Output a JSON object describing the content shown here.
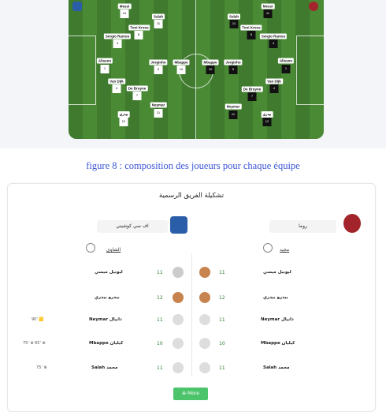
{
  "caption": "figure 8 : composition des joueurs pour chaque équipe",
  "pitch": {
    "left_cards": [
      "Salah",
      "Neymar",
      "Toni Kroos",
      "Sergio Ramos",
      "Alisson",
      "Van Dijk",
      "De Bruyne",
      "Jorginho",
      "Mbappe",
      "Neymar"
    ],
    "right_cards": [
      "Salah",
      "Neymar",
      "Toni Kroos",
      "Sergio Ramos",
      "Alisson",
      "Van Dijk",
      "De Bruyne",
      "Mbappe",
      "Jorginho",
      "Neymar"
    ],
    "left_mid_cards": [
      "Jorginho",
      "Mbappe"
    ],
    "right_mid_cards": [
      "Mbappe",
      "Jorginho"
    ]
  },
  "panel": {
    "title": "تشكيلة الفريق الرسمية",
    "team_left": "اف سي كوشيني",
    "team_right": "روما",
    "sec_left": "الشاوي",
    "sec_right": "مجيد",
    "more_label": "⊕ More",
    "rows": [
      {
        "left_name": "ليونيل ميسي",
        "left_num": "11",
        "right_num": "11",
        "right_name": "ليونيل ميسي",
        "left_ev": ""
      },
      {
        "left_name": "بيدرو بيدري",
        "left_num": "12",
        "right_num": "12",
        "right_name": "بيدرو بيدري",
        "left_ev": ""
      },
      {
        "left_name": "Neymar دانيال",
        "left_num": "11",
        "right_num": "11",
        "right_name": "Neymar دانيال",
        "left_ev": "90' 🟨"
      },
      {
        "left_name": "Mbappe كيليان",
        "left_num": "10",
        "right_num": "10",
        "right_name": "Mbappe كيليان",
        "left_ev": "75' ⊗ 65' ⊗"
      },
      {
        "left_name": "Salah محمد",
        "left_num": "11",
        "right_num": "11",
        "right_name": "Salah محمد",
        "left_ev": "75' ⊗"
      }
    ]
  },
  "colors": {
    "accent": "#4cc46b",
    "caption": "#3b55d6"
  }
}
